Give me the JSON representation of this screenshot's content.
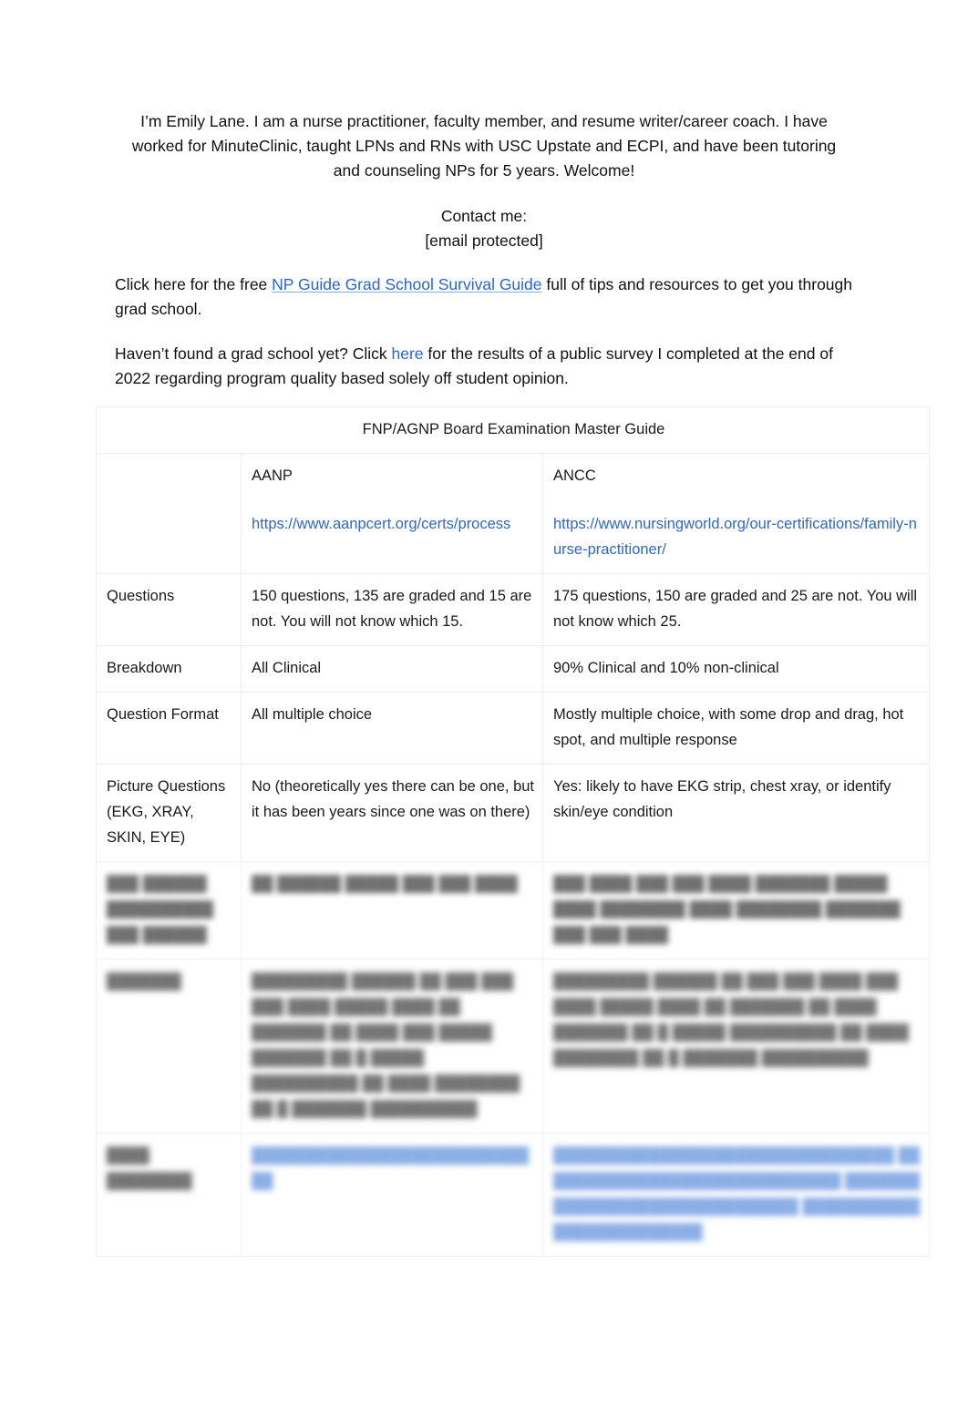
{
  "document": {
    "intro_paragraph": "I’m Emily Lane. I am a nurse practitioner, faculty member, and resume writer/career coach. I have worked for MinuteClinic, taught LPNs and RNs with USC Upstate and ECPI, and have been tutoring and counseling NPs for 5 years. Welcome!",
    "contact_label": "Contact me:",
    "contact_email": "[email protected]",
    "paragraph_1": {
      "before_link": "Click here for the free ",
      "link_text": "NP Guide Grad School Survival Guide",
      "after_link": " full of tips and resources to get you through grad school."
    },
    "paragraph_2": {
      "before_link": "Haven’t found a grad school yet? Click ",
      "link_text": "here",
      "after_link": " for the results of a public survey I completed at the end of 2022 regarding program quality based solely off student opinion."
    }
  },
  "table": {
    "title": "FNP/AGNP Board Examination Master Guide",
    "column_headers": {
      "row_label": "",
      "aanp": "AANP",
      "ancc": "ANCC"
    },
    "urls": {
      "aanp": "https://www.aanpcert.org/certs/process",
      "ancc": "https://www.nursingworld.org/our-certifications/family-nurse-practitioner/"
    },
    "rows": [
      {
        "label": "Questions",
        "aanp": "150 questions, 135 are graded and 15 are not. You will not know which 15.",
        "ancc": "175 questions, 150 are graded and 25 are not. You will not know which 25.",
        "redacted": false
      },
      {
        "label": "Breakdown",
        "aanp": "All Clinical",
        "ancc": "90% Clinical and 10% non-clinical",
        "redacted": false
      },
      {
        "label": "Question Format",
        "aanp": "All multiple choice",
        "ancc": "Mostly multiple choice, with some drop and drag, hot spot, and multiple response",
        "redacted": false
      },
      {
        "label": "Picture Questions (EKG, XRAY, SKIN, EYE)",
        "aanp": "No (theoretically yes there can be one, but it has been years since one was on there)",
        "ancc": "Yes: likely to have EKG strip, chest xray, or identify skin/eye condition",
        "redacted": false
      },
      {
        "label": "███ ██████ ██████████ ███ ██████",
        "aanp": "██ ██████ █████ ███ ███ ████",
        "ancc": "███ ████ ███ ███ ████ ███████ █████ ████ ████████ ████ ████████ ███████ ███ ███ ████",
        "redacted": true
      },
      {
        "label": "███████",
        "aanp": "█████████ ██████ ██ ███ ███ ███ ████ █████ ████ ██ ███████ ██ ████ ███ █████ ███████ ██ █ █████ ██████████ ██ ████ ████████ ██ █ ███████ ██████████",
        "ancc": "█████████ ██████ ██ ███ ███ ████ ███ ████ █████ ████ ██ ███████ ██ ████ ███████ ██ █ █████ ██████████ ██ ████ ████████ ██ █ ███████ ██████████",
        "redacted": true
      },
      {
        "label": "████ ████████",
        "aanp": "████████████████████████████",
        "ancc": "████████████████████████████████ █████████████████████████████ ██████████████████████████████ █████████████████████████",
        "redacted": true,
        "link_style": true
      }
    ]
  },
  "colors": {
    "body_link": "#2a66cc",
    "table_link": "#3268bd",
    "table_border": "#eceded",
    "text": "#1a1a1a",
    "background": "#ffffff"
  }
}
